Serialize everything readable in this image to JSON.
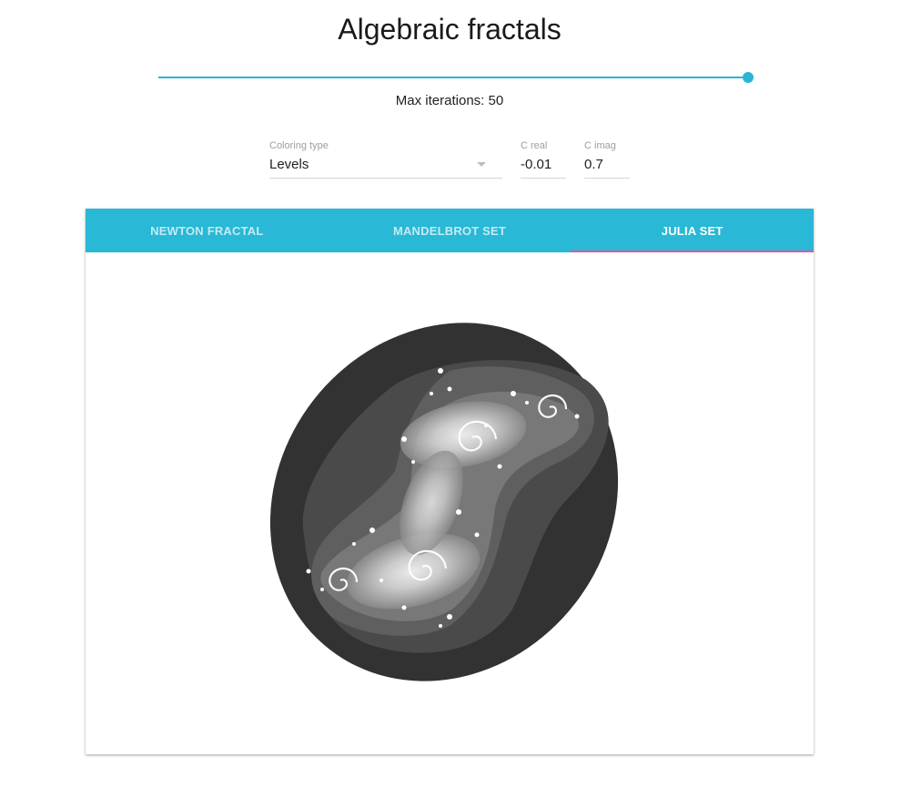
{
  "header": {
    "title": "Algebraic fractals"
  },
  "iterations": {
    "label": "Max iterations: 50",
    "value": 50,
    "fill_fraction": 1.0
  },
  "controls": {
    "coloring": {
      "label": "Coloring type",
      "value": "Levels"
    },
    "c_real": {
      "label": "C real",
      "value": "-0.01"
    },
    "c_imag": {
      "label": "C imag",
      "value": "0.7"
    }
  },
  "tabs": [
    {
      "label": "NEWTON FRACTAL",
      "active": false
    },
    {
      "label": "MANDELBROT SET",
      "active": false
    },
    {
      "label": "JULIA SET",
      "active": true
    }
  ],
  "colors": {
    "accent": "#29b6d6",
    "tab_bar": "#29b8d5",
    "tab_indicator": "#e8559a",
    "fractal_background": "#323232"
  }
}
